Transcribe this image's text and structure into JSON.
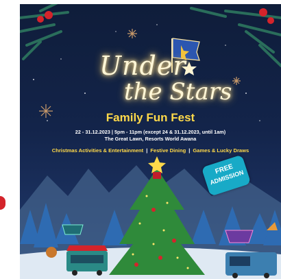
{
  "poster": {
    "title_line1": "Under",
    "title_line2": "the Stars",
    "subtitle": "Family Fun Fest",
    "dates": "22 - 31.12.2023  |  5pm - 11pm (except 24 & 31.12.2023, until 1am)",
    "venue": "The Great Lawn, Resorts World Awana",
    "activities": [
      "Christmas Activities & Entertainment",
      "Festive Dining",
      "Games & Lucky Draws"
    ],
    "badge_line1": "FREE",
    "badge_line2": "ADMISSION"
  },
  "colors": {
    "accent_yellow": "#ffd94a",
    "badge_blue": "#18aac7",
    "sky_dark": "#0f1d3a",
    "tree_green": "#2f8a3a"
  },
  "icons": [
    "flag-icon",
    "star-icon",
    "snowflake-icon",
    "ornament-icon",
    "food-truck-icon"
  ]
}
